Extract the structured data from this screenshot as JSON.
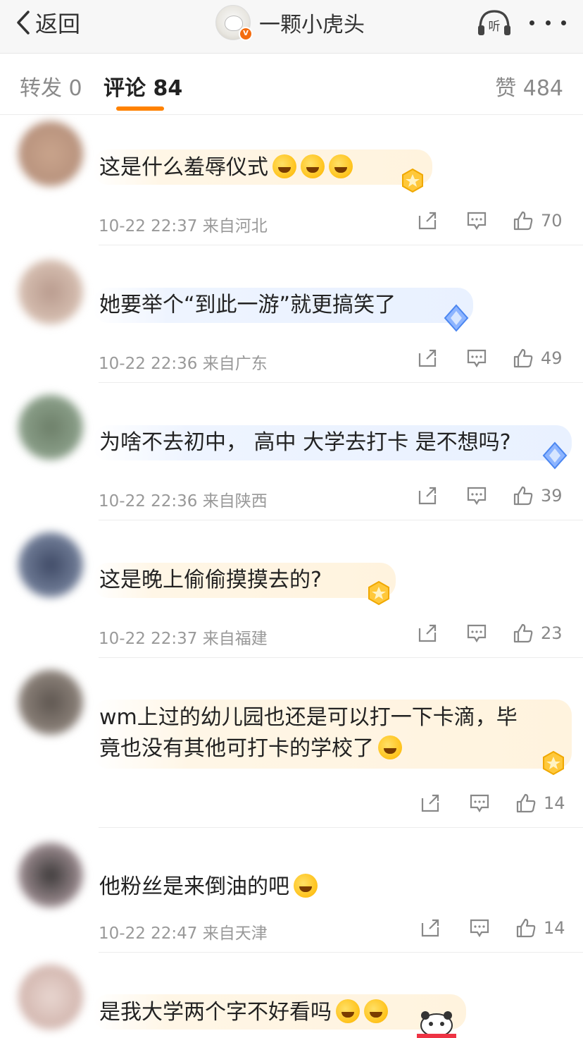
{
  "header": {
    "back_label": "返回",
    "title": "一颗小虎头",
    "verified_badge": "V",
    "listen_icon": "headphones-listen-icon",
    "more_icon": "more-dots-icon"
  },
  "tabs": {
    "repost": "转发 0",
    "comment": "评论 84",
    "likes": "赞 484"
  },
  "comments": [
    {
      "text": "这是什么羞辱仪式",
      "emoji_count": 3,
      "time": "10-22 22:37",
      "location": "来自河北",
      "likes": "70",
      "badge": "gold-star-badge"
    },
    {
      "text": "她要举个“到此一游”就更搞笑了",
      "emoji_count": 0,
      "time": "10-22 22:36",
      "location": "来自广东",
      "likes": "49",
      "badge": "blue-diamond-badge"
    },
    {
      "text": "为啥不去初中， 高中 大学去打卡 是不想吗?",
      "emoji_count": 0,
      "time": "10-22 22:36",
      "location": "来自陕西",
      "likes": "39",
      "badge": "blue-diamond-badge"
    },
    {
      "text": "这是晚上偷偷摸摸去的?",
      "emoji_count": 0,
      "time": "10-22 22:37",
      "location": "来自福建",
      "likes": "23",
      "badge": "gold-star-badge"
    },
    {
      "text_line1": "wm上过的幼儿园也还是可以打一下卡滴，毕",
      "text_line2": "竟也没有其他可打卡的学校了",
      "emoji_count": 1,
      "time": "",
      "location": "",
      "likes": "14",
      "badge": "gold-star-badge"
    },
    {
      "text": "他粉丝是来倒油的吧",
      "emoji_count": 1,
      "time": "10-22 22:47",
      "location": "来自天津",
      "likes": "14",
      "badge": ""
    },
    {
      "text": "是我大学两个字不好看吗",
      "emoji_count": 2,
      "time": "",
      "location": "",
      "likes": "",
      "badge": "panda-sticker"
    }
  ],
  "colors": {
    "accent": "#ff8200",
    "gold_bubble": "#fff3de",
    "blue_bubble": "#e9f1ff",
    "meta": "#999999"
  }
}
